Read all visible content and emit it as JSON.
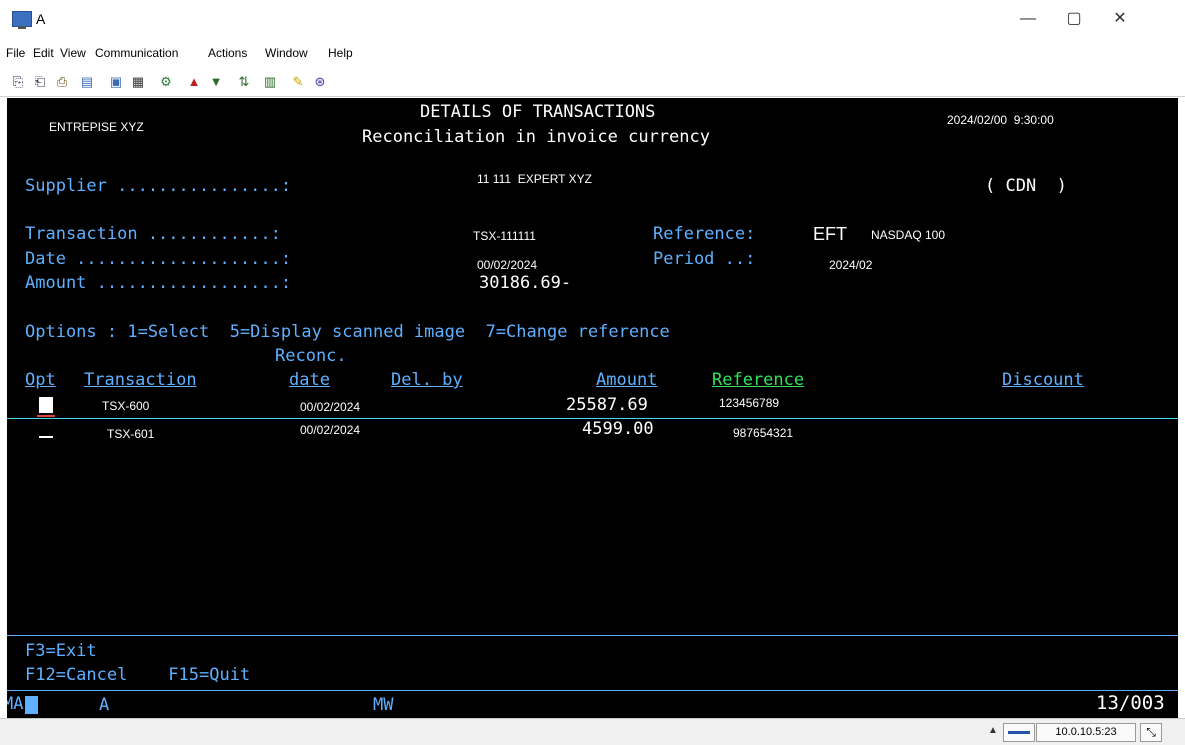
{
  "window": {
    "title": "A",
    "buttons": {
      "minimize": "—",
      "maximize": "▢",
      "close": "✕"
    }
  },
  "menu": [
    "File",
    "Edit",
    "View",
    "Communication",
    "Actions",
    "Window",
    "Help"
  ],
  "toolbar_icons": [
    "copy-icon",
    "paste-icon",
    "print-icon",
    "clipboard-icon",
    "display-icon",
    "keyboard-icon",
    "macro-icon",
    "send-icon",
    "receive-icon",
    "transfer-icon",
    "chart-icon",
    "notes-icon",
    "help-icon"
  ],
  "screen": {
    "company": "ENTREPISE XYZ",
    "title": "DETAILS OF TRANSACTIONS",
    "subtitle": "Reconciliation in invoice currency",
    "datetime": "2024/02/00  9:30:00",
    "supplier_label": "Supplier ................:",
    "supplier_value": "11 111  EXPERT XYZ",
    "currency": "( CDN  )",
    "transaction_label": "Transaction ............:",
    "transaction_value": "TSX-111111",
    "date_label": "Date ....................:",
    "date_value": "00/02/2024",
    "amount_label": "Amount ..................:",
    "amount_value": "30186.69-",
    "reference_label": "Reference:",
    "reference_prefix": "EFT",
    "reference_value": "NASDAQ 100",
    "period_label": "Period ..:",
    "period_value": "2024/02",
    "options": "Options : 1=Select  5=Display scanned image  7=Change reference",
    "columns": {
      "reconc": "Reconc.",
      "opt": "Opt",
      "transaction": "Transaction",
      "date": "date",
      "del_by": "Del. by",
      "amount": "Amount",
      "reference": "Reference",
      "discount": "Discount"
    },
    "rows": [
      {
        "transaction": "TSX-600",
        "date": "00/02/2024",
        "amount": "25587.69",
        "reference": "123456789"
      },
      {
        "transaction": "TSX-601",
        "date": "00/02/2024",
        "amount": "4599.00",
        "reference": "987654321"
      }
    ],
    "fkeys_1": "F3=Exit",
    "fkeys_2": "F12=Cancel    F15=Quit",
    "oia_left": "MA",
    "oia_a": "A",
    "oia_mw": "MW",
    "oia_pos": "13/003"
  },
  "status": {
    "ip": "10.0.10.5:23"
  },
  "colors": {
    "screen_bg": "#000000",
    "green": "#33e05a",
    "blue": "#5fb0ff",
    "white": "#ffffff"
  }
}
